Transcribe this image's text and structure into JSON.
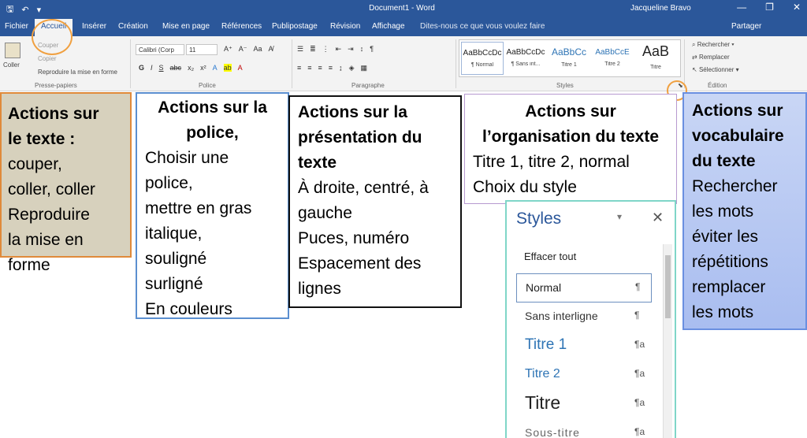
{
  "titlebar": {
    "save_glyph": "🖫",
    "undo_glyph": "↶",
    "qat_more": "▾",
    "doc_title": "Document1 - Word",
    "user": "Jacqueline Bravo",
    "min": "—",
    "restore": "❐",
    "close": "✕"
  },
  "tabs": [
    {
      "label": "Fichier"
    },
    {
      "label": "Accueil"
    },
    {
      "label": "Insérer"
    },
    {
      "label": "Création"
    },
    {
      "label": "Mise en page"
    },
    {
      "label": "Références"
    },
    {
      "label": "Publipostage"
    },
    {
      "label": "Révision"
    },
    {
      "label": "Affichage"
    }
  ],
  "tellme": "Dites-nous ce que vous voulez faire",
  "share": "Partager",
  "ribbon": {
    "clipboard": {
      "paste": "Coller",
      "cut": "Couper",
      "copy": "Copier",
      "format_painter": "Reproduire la mise en forme",
      "label": "Presse-papiers"
    },
    "font": {
      "font_name": "Calibri (Corp",
      "font_size": "11",
      "label": "Police"
    },
    "paragraph": {
      "label": "Paragraphe"
    },
    "styles": {
      "label": "Styles",
      "tiles": [
        {
          "sample": "AaBbCcDc",
          "name": "¶ Normal"
        },
        {
          "sample": "AaBbCcDc",
          "name": "¶ Sans int..."
        },
        {
          "sample": "AaBbCc",
          "name": "Titre 1"
        },
        {
          "sample": "AaBbCcE",
          "name": "Titre 2"
        },
        {
          "sample": "AaB",
          "name": "Titre"
        }
      ]
    },
    "editing": {
      "find": "Rechercher",
      "replace": "Remplacer",
      "select": "Sélectionner",
      "label": "Édition"
    }
  },
  "boxes": {
    "texte": {
      "title1": "Actions sur",
      "title2": "le texte :",
      "l1": "couper,",
      "l2": "coller, coller",
      "l3": "Reproduire",
      "l4": "la mise en",
      "l5": "forme"
    },
    "police": {
      "title1": "Actions sur la",
      "title2": "police,",
      "l1": "Choisir une",
      "l2": "police,",
      "l3": "mettre en gras",
      "l4": "italique,",
      "l5": "souligné",
      "l6": "surligné",
      "l7": "En couleurs"
    },
    "presentation": {
      "title1": "Actions sur la",
      "title2": "présentation du",
      "title3": "texte",
      "l1": "À droite, centré, à",
      "l2": "gauche",
      "l3": "Puces, numéro",
      "l4": "Espacement des",
      "l5": "lignes"
    },
    "organisation": {
      "title1": "Actions sur",
      "title2": "l’organisation du texte",
      "l1": "Titre 1, titre 2, normal",
      "l2": "Choix du style"
    },
    "vocabulaire": {
      "title1": "Actions sur",
      "title2": "vocabulaire",
      "title3": "du texte",
      "l1": "Rechercher",
      "l2": "les mots",
      "l3": "éviter les",
      "l4": "répétitions",
      "l5": "remplacer",
      "l6": "les mots"
    }
  },
  "styles_pane": {
    "title": "Styles",
    "menu": "▾",
    "close": "✕",
    "items": [
      {
        "name": "Effacer tout",
        "mark": ""
      },
      {
        "name": "Normal",
        "mark": "¶"
      },
      {
        "name": "Sans interligne",
        "mark": "¶"
      },
      {
        "name": "Titre 1",
        "mark": "¶a"
      },
      {
        "name": "Titre 2",
        "mark": "¶a"
      },
      {
        "name": "Titre",
        "mark": "¶a"
      },
      {
        "name": "Sous-titre",
        "mark": "¶a"
      }
    ]
  },
  "colors": {
    "word_blue": "#2b579a",
    "highlight_orange": "#f0a040"
  }
}
